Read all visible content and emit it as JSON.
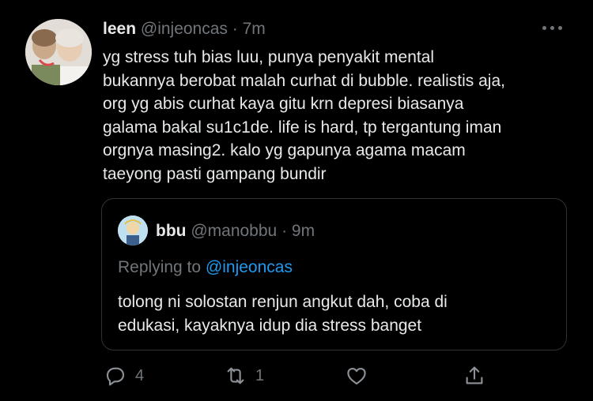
{
  "tweet": {
    "name": "leen",
    "handle": "@injeoncas",
    "dot": "·",
    "time": "7m",
    "text": "yg stress tuh bias luu, punya penyakit mental\nbukannya berobat malah curhat di bubble. realistis aja,\norg yg abis curhat kaya gitu krn depresi biasanya\ngalama bakal su1c1de. life is hard, tp tergantung iman\norgnya masing2. kalo yg gapunya agama macam\ntaeyong pasti gampang bundir"
  },
  "quote": {
    "name": "bbu",
    "handle": "@manobbu",
    "dot": "·",
    "time": "9m",
    "replying_prefix": "Replying to ",
    "replying_to": "@injeoncas",
    "text": "tolong ni solostan renjun angkut dah, coba di\nedukasi, kayaknya idup dia stress banget"
  },
  "actions": {
    "reply_count": "4",
    "retweet_count": "1"
  },
  "colors": {
    "background": "#000000",
    "text": "#e7e9ea",
    "muted": "#71767b",
    "link": "#1d9bf0",
    "border": "#2f3336"
  },
  "icons": [
    "more-icon",
    "reply-icon",
    "retweet-icon",
    "like-icon",
    "share-icon"
  ]
}
